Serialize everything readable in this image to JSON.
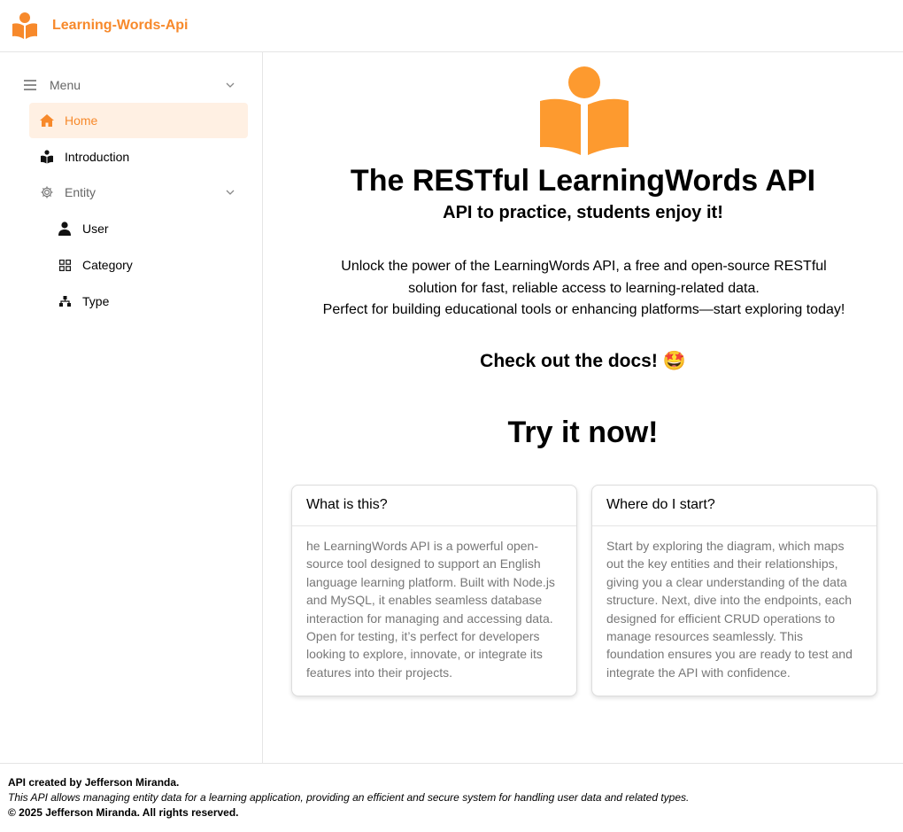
{
  "header": {
    "brand_name": "Learning-Words-Api",
    "brand_icon": "reader-icon",
    "accent_color": "#f7892b"
  },
  "sidebar": {
    "menu_label": "Menu",
    "items": [
      {
        "label": "Home",
        "icon": "home-icon",
        "active": true
      },
      {
        "label": "Introduction",
        "icon": "reader-icon"
      },
      {
        "label": "Entity",
        "icon": "gear-icon"
      },
      {
        "label": "User",
        "icon": "user-icon"
      },
      {
        "label": "Category",
        "icon": "grid-icon"
      },
      {
        "label": "Type",
        "icon": "hierarchy-icon"
      }
    ]
  },
  "main": {
    "title": "The RESTful LearningWords API",
    "subtitle": "API to practice, students enjoy it!",
    "description_lines": [
      "Unlock the power of the LearningWords API, a free and open-source RESTful",
      "solution for fast, reliable access to learning-related data.",
      "Perfect for building educational tools or enhancing platforms—start exploring today!"
    ],
    "docs_text": "Check out the docs! 🤩",
    "try_text": "Try it now!",
    "cards": [
      {
        "title": "What is this?",
        "body": "he LearningWords API is a powerful open-source tool designed to support an English language learning platform. Built with Node.js and MySQL, it enables seamless database interaction for managing and accessing data. Open for testing, it’s perfect for developers looking to explore, innovate, or integrate its features into their projects."
      },
      {
        "title": "Where do I start?",
        "body": "Start by exploring the diagram, which maps out the key entities and their relationships, giving you a clear understanding of the data structure. Next, dive into the endpoints, each designed for efficient CRUD operations to manage resources seamlessly. This foundation ensures you are ready to test and integrate the API with confidence."
      }
    ]
  },
  "footer": {
    "created_by": "API created by Jefferson Miranda.",
    "description": "This API allows managing entity data for a learning application, providing an efficient and secure system for handling user data and related types.",
    "copyright": "© 2025 Jefferson Miranda. All rights reserved."
  }
}
